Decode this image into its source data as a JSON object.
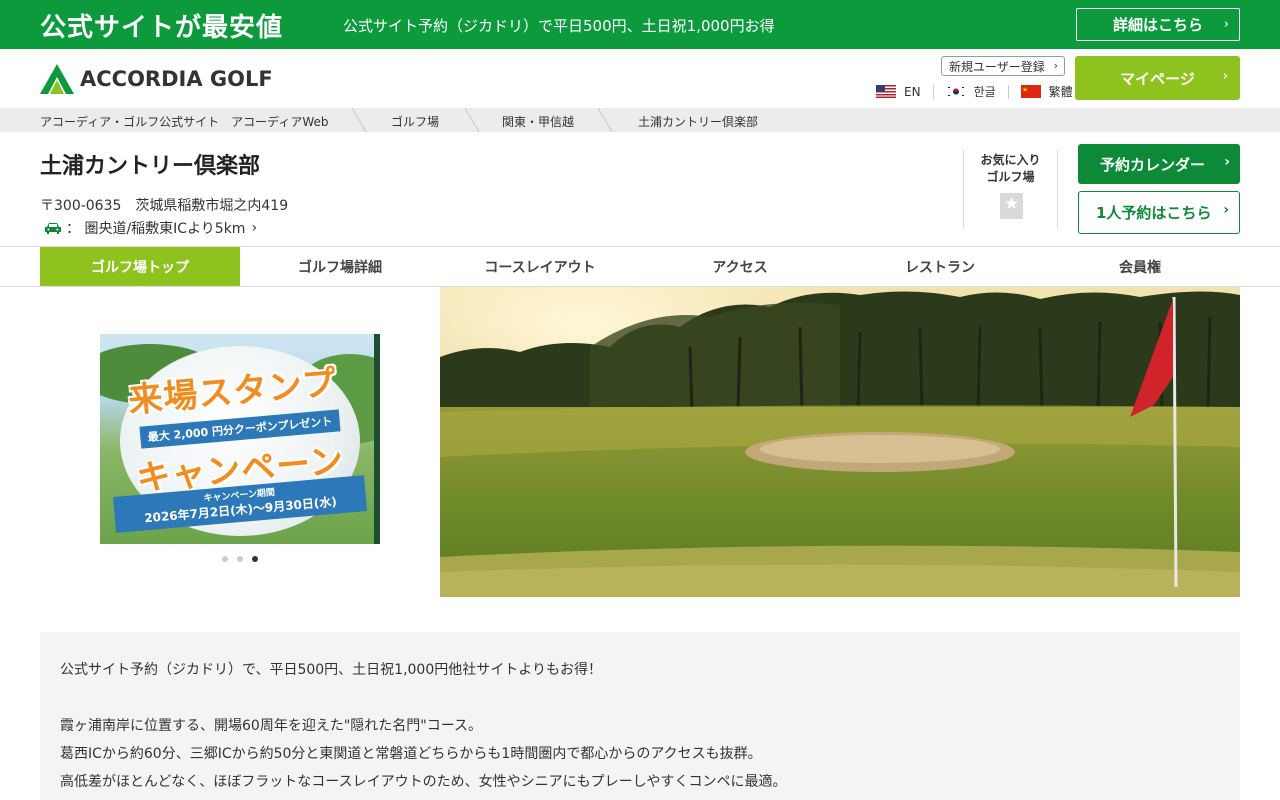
{
  "promo": {
    "title": "公式サイトが最安値",
    "text": "公式サイト予約（ジカドリ）で平日500円、土日祝1,000円お得",
    "button": "詳細はこちら"
  },
  "header": {
    "logo_text": "ACCORDIA GOLF",
    "register": "新規ユーザー登録",
    "languages": [
      {
        "label": "EN",
        "flag": "us-flag-icon"
      },
      {
        "label": "한글",
        "flag": "kr-flag-icon"
      },
      {
        "label": "繁體",
        "flag": "cn-flag-icon"
      }
    ],
    "mypage": "マイページ"
  },
  "breadcrumb": [
    "アコーディア・ゴルフ公式サイト　アコーディアWeb",
    "ゴルフ場",
    "関東・甲信越",
    "土浦カントリー倶楽部"
  ],
  "course": {
    "name": "土浦カントリー倶楽部",
    "address": "〒300-0635　茨城県稲敷市堀之内419",
    "access": "圏央道/稲敷東ICより5km",
    "favorite": [
      "お気に入り",
      "ゴルフ場"
    ],
    "calendar_button": "予約カレンダー",
    "single_button": "1人予約はこちら"
  },
  "tabs": [
    {
      "label": "ゴルフ場トップ",
      "active": true
    },
    {
      "label": "ゴルフ場詳細",
      "active": false
    },
    {
      "label": "コースレイアウト",
      "active": false
    },
    {
      "label": "アクセス",
      "active": false
    },
    {
      "label": "レストラン",
      "active": false
    },
    {
      "label": "会員権",
      "active": false
    }
  ],
  "banner": {
    "line1": "来場スタンプ",
    "ribbon": "最大 2,000 円分クーポンプレゼント",
    "line2": "キャンペーン",
    "period_label": "キャンペーン期間",
    "period": "2026年7月2日(木)～9月30日(水)",
    "slides": 3,
    "active_slide": 3
  },
  "info": {
    "lead": "公式サイト予約（ジカドリ）で、平日500円、土日祝1,000円他社サイトよりもお得！",
    "lines": [
      "霞ヶ浦南岸に位置する、開場60周年を迎えた\"隠れた名門\"コース。",
      "葛西ICから約60分、三郷ICから約50分と東関道と常磐道どちらからも1時間圏内で都心からのアクセスも抜群。",
      "高低差がほとんどなく、ほぼフラットなコースレイアウトのため、女性やシニアにもプレーしやすくコンペに最適。"
    ]
  },
  "colors": {
    "brand_green": "#0c9a3c",
    "dark_green": "#0c8a37",
    "lime": "#8ec31f"
  }
}
